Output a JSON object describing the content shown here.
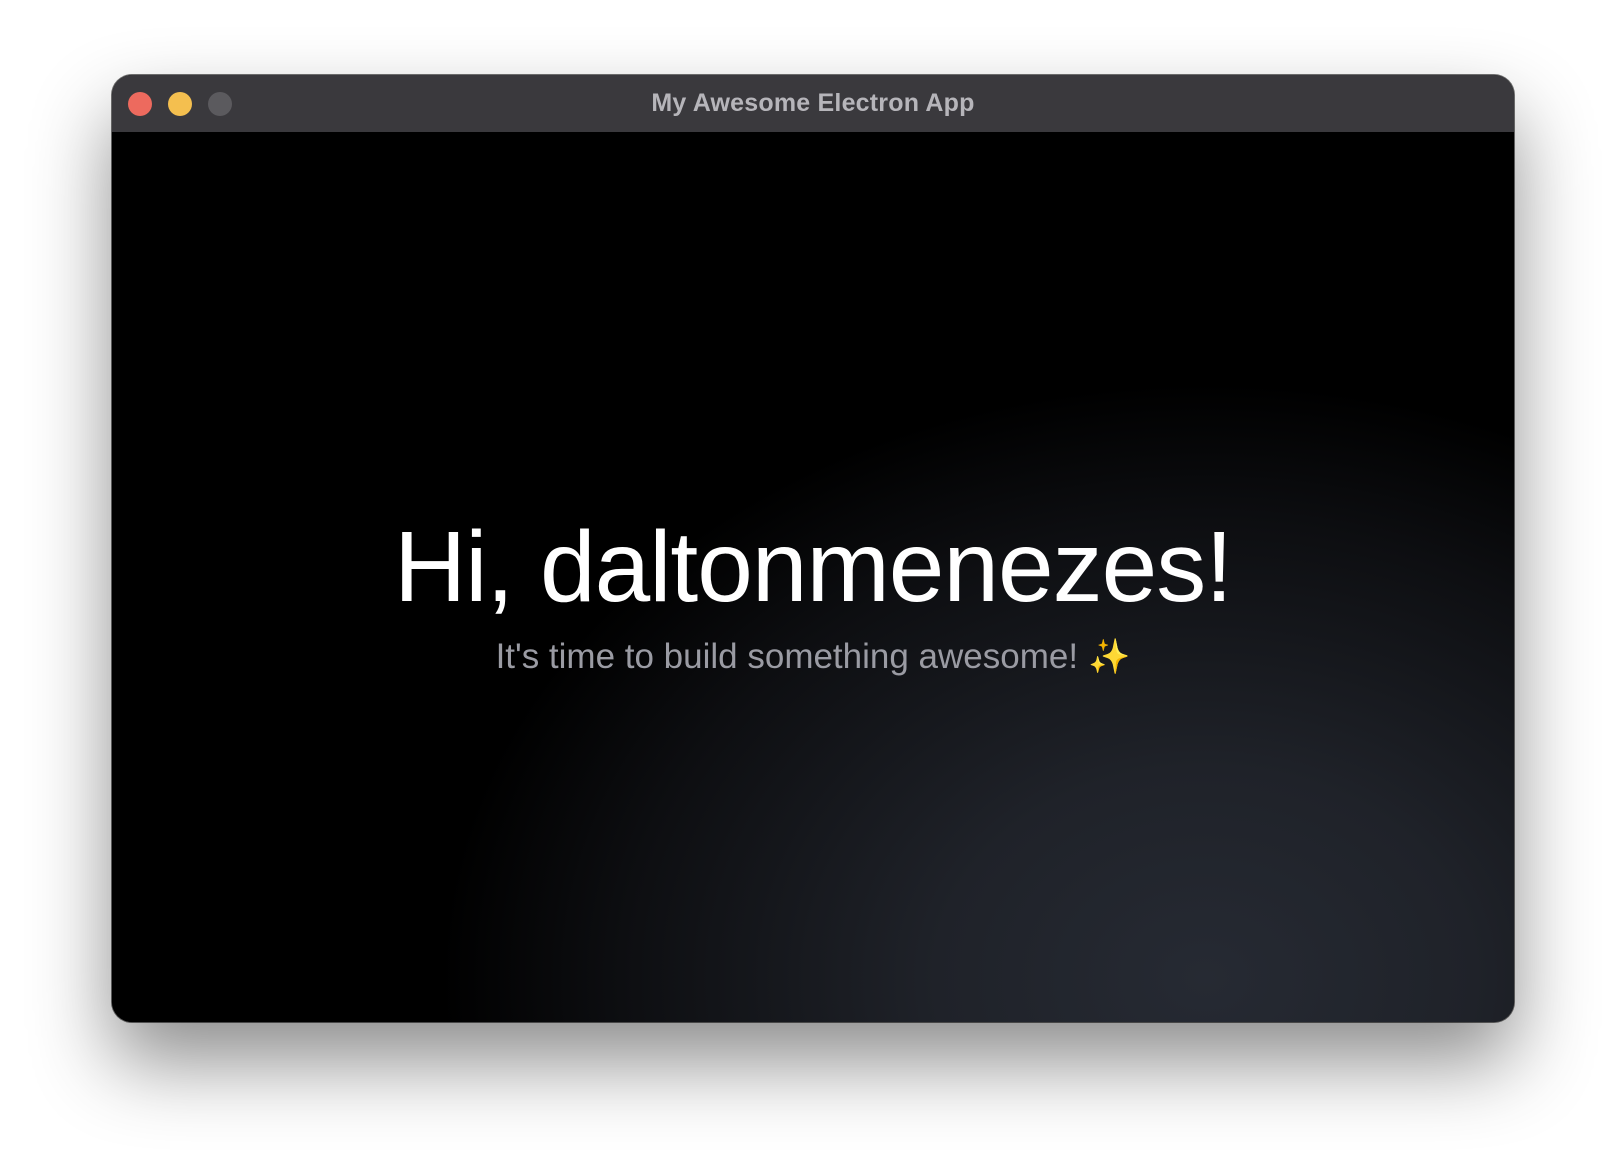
{
  "window": {
    "title": "My Awesome Electron App"
  },
  "traffic_lights": {
    "close": "#ed6a5e",
    "minimize": "#f4bf4f",
    "maximize": "#5b5a5e"
  },
  "content": {
    "headline": "Hi, daltonmenezes!",
    "subline": "It's time to build something awesome!",
    "sparkle": "✨"
  }
}
